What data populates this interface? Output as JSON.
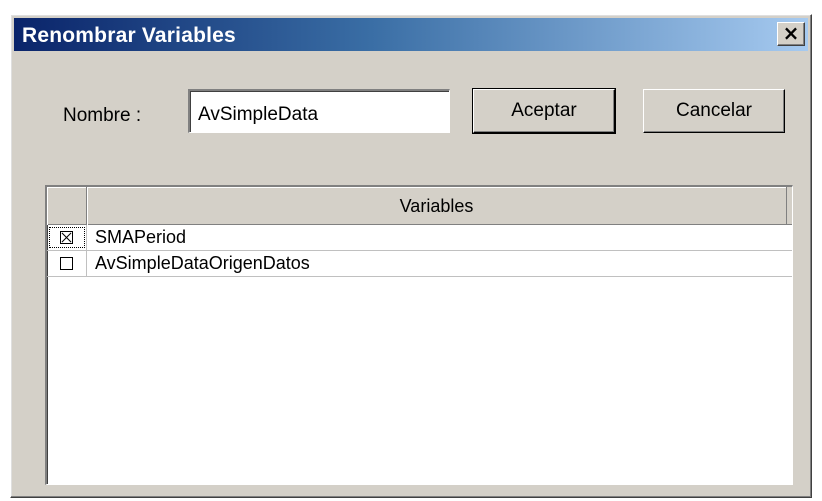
{
  "dialog": {
    "title": "Renombrar Variables",
    "close_label": "×"
  },
  "form": {
    "nombre_label": "Nombre :",
    "nombre_value": "AvSimpleData",
    "aceptar_label": "Aceptar",
    "cancelar_label": "Cancelar"
  },
  "grid": {
    "column_header": "Variables",
    "rows": [
      {
        "name": "SMAPeriod",
        "checked": true
      },
      {
        "name": "AvSimpleDataOrigenDatos",
        "checked": false
      }
    ]
  },
  "colors": {
    "titlebar_start": "#0a246a",
    "titlebar_end": "#a6caf0",
    "window_face": "#d4d0c8"
  }
}
